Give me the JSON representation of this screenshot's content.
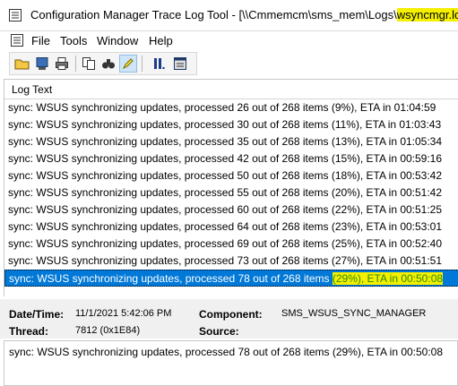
{
  "window": {
    "title_prefix": "Configuration Manager Trace Log Tool - [\\\\Cmmemcm\\sms_mem\\Logs\\",
    "title_highlight": "wsyncmgr.log",
    "title_suffix": "]"
  },
  "menu": {
    "items": [
      "File",
      "Tools",
      "Window",
      "Help"
    ]
  },
  "toolbar": {
    "buttons": [
      "open-icon",
      "print-preview-icon",
      "print-icon",
      "copy-icon",
      "find-icon",
      "highlight-icon",
      "pause-icon",
      "error-lookup-icon"
    ]
  },
  "log": {
    "column_header": "Log Text",
    "rows": [
      "sync: WSUS synchronizing updates, processed 26 out of 268 items (9%), ETA in 01:04:59",
      "sync: WSUS synchronizing updates, processed 30 out of 268 items (11%), ETA in 01:03:43",
      "sync: WSUS synchronizing updates, processed 35 out of 268 items (13%), ETA in 01:05:34",
      "sync: WSUS synchronizing updates, processed 42 out of 268 items (15%), ETA in 00:59:16",
      "sync: WSUS synchronizing updates, processed 50 out of 268 items (18%), ETA in 00:53:42",
      "sync: WSUS synchronizing updates, processed 55 out of 268 items (20%), ETA in 00:51:42",
      "sync: WSUS synchronizing updates, processed 60 out of 268 items (22%), ETA in 00:51:25",
      "sync: WSUS synchronizing updates, processed 64 out of 268 items (23%), ETA in 00:53:01",
      "sync: WSUS synchronizing updates, processed 69 out of 268 items (25%), ETA in 00:52:40",
      "sync: WSUS synchronizing updates, processed 73 out of 268 items (27%), ETA in 00:51:51"
    ],
    "selected_prefix": "sync: WSUS synchronizing updates, processed 78 out of 268 items ",
    "selected_highlight": "(29%), ETA in 00:50:08"
  },
  "details": {
    "datetime_label": "Date/Time:",
    "datetime_value": "11/1/2021 5:42:06 PM",
    "component_label": "Component:",
    "component_value": "SMS_WSUS_SYNC_MANAGER",
    "thread_label": "Thread:",
    "thread_value": "7812 (0x1E84)",
    "source_label": "Source:",
    "source_value": ""
  },
  "message": {
    "text": "sync: WSUS synchronizing updates, processed 78 out of 268 items (29%), ETA in 00:50:08"
  },
  "colors": {
    "selection": "#0078d7",
    "highlight": "#f4f000"
  }
}
